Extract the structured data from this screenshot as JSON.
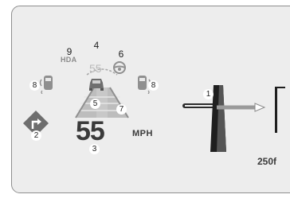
{
  "cluster": {
    "hda_label": "HDA",
    "set_speed": "55",
    "current_speed": "55",
    "speed_unit": "MPH",
    "distance": "250f"
  },
  "callouts": {
    "c1": "1",
    "c2": "2",
    "c3": "3",
    "c4": "4",
    "c5": "5",
    "c6": "6",
    "c7": "7",
    "c8_left": "8",
    "c8_right": "8",
    "c9": "9"
  },
  "icons": {
    "turn_sign": "turn-right-diamond-icon",
    "lead_vehicle": "lead-vehicle-icon",
    "left_car": "left-car-warning-icon",
    "right_car": "right-car-warning-icon",
    "steering": "steering-wheel-icon",
    "road": "lane-road-icon",
    "nav_arrow": "navigation-turn-arrow-icon"
  },
  "colors": {
    "screen_bg": "#ededed",
    "icon_gray": "#8f8f8f",
    "dark": "#3a3a3a"
  }
}
